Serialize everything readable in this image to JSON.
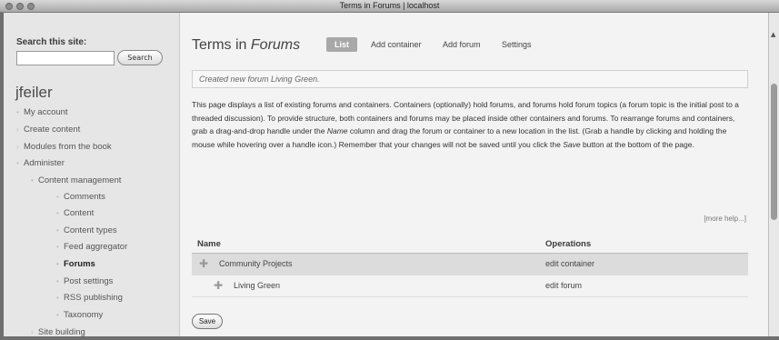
{
  "window": {
    "title": "Terms in Forums | localhost"
  },
  "sidebar": {
    "search_label": "Search this site:",
    "search_value": "",
    "search_button": "Search",
    "username": "jfeiler",
    "items": [
      {
        "label": "My account"
      },
      {
        "label": "Create content"
      },
      {
        "label": "Modules from the book"
      },
      {
        "label": "Administer"
      },
      {
        "label": "Content management"
      },
      {
        "label": "Comments"
      },
      {
        "label": "Content"
      },
      {
        "label": "Content types"
      },
      {
        "label": "Feed aggregator"
      },
      {
        "label": "Forums"
      },
      {
        "label": "Post settings"
      },
      {
        "label": "RSS publishing"
      },
      {
        "label": "Taxonomy"
      },
      {
        "label": "Site building"
      }
    ]
  },
  "main": {
    "title_prefix": "Terms in ",
    "title_emph": "Forums",
    "tabs": [
      {
        "label": "List"
      },
      {
        "label": "Add container"
      },
      {
        "label": "Add forum"
      },
      {
        "label": "Settings"
      }
    ],
    "message_prefix": "Created new forum ",
    "message_emph": "Living Green",
    "message_suffix": ".",
    "desc": {
      "p1": "This page displays a list of existing forums and containers. Containers (optionally) hold forums, and forums hold forum topics (a forum topic is the initial post to a threaded discussion). To provide structure, both containers and forums may be placed inside other containers and forums. To rearrange forums and containers, grab a drag-and-drop handle under the ",
      "name_word": "Name",
      "p2": " column and drag the forum or container to a new location in the list. (Grab a handle by clicking and holding the mouse while hovering over a handle icon.) Remember that your changes will not be saved until you click the ",
      "save_word": "Save",
      "p3": " button at the bottom of the page."
    },
    "more_help": "[more help...]",
    "table": {
      "headers": {
        "name": "Name",
        "operations": "Operations"
      },
      "rows": [
        {
          "name": "Community Projects",
          "operation": "edit container"
        },
        {
          "name": "Living Green",
          "operation": "edit forum"
        }
      ]
    },
    "save_button": "Save"
  }
}
